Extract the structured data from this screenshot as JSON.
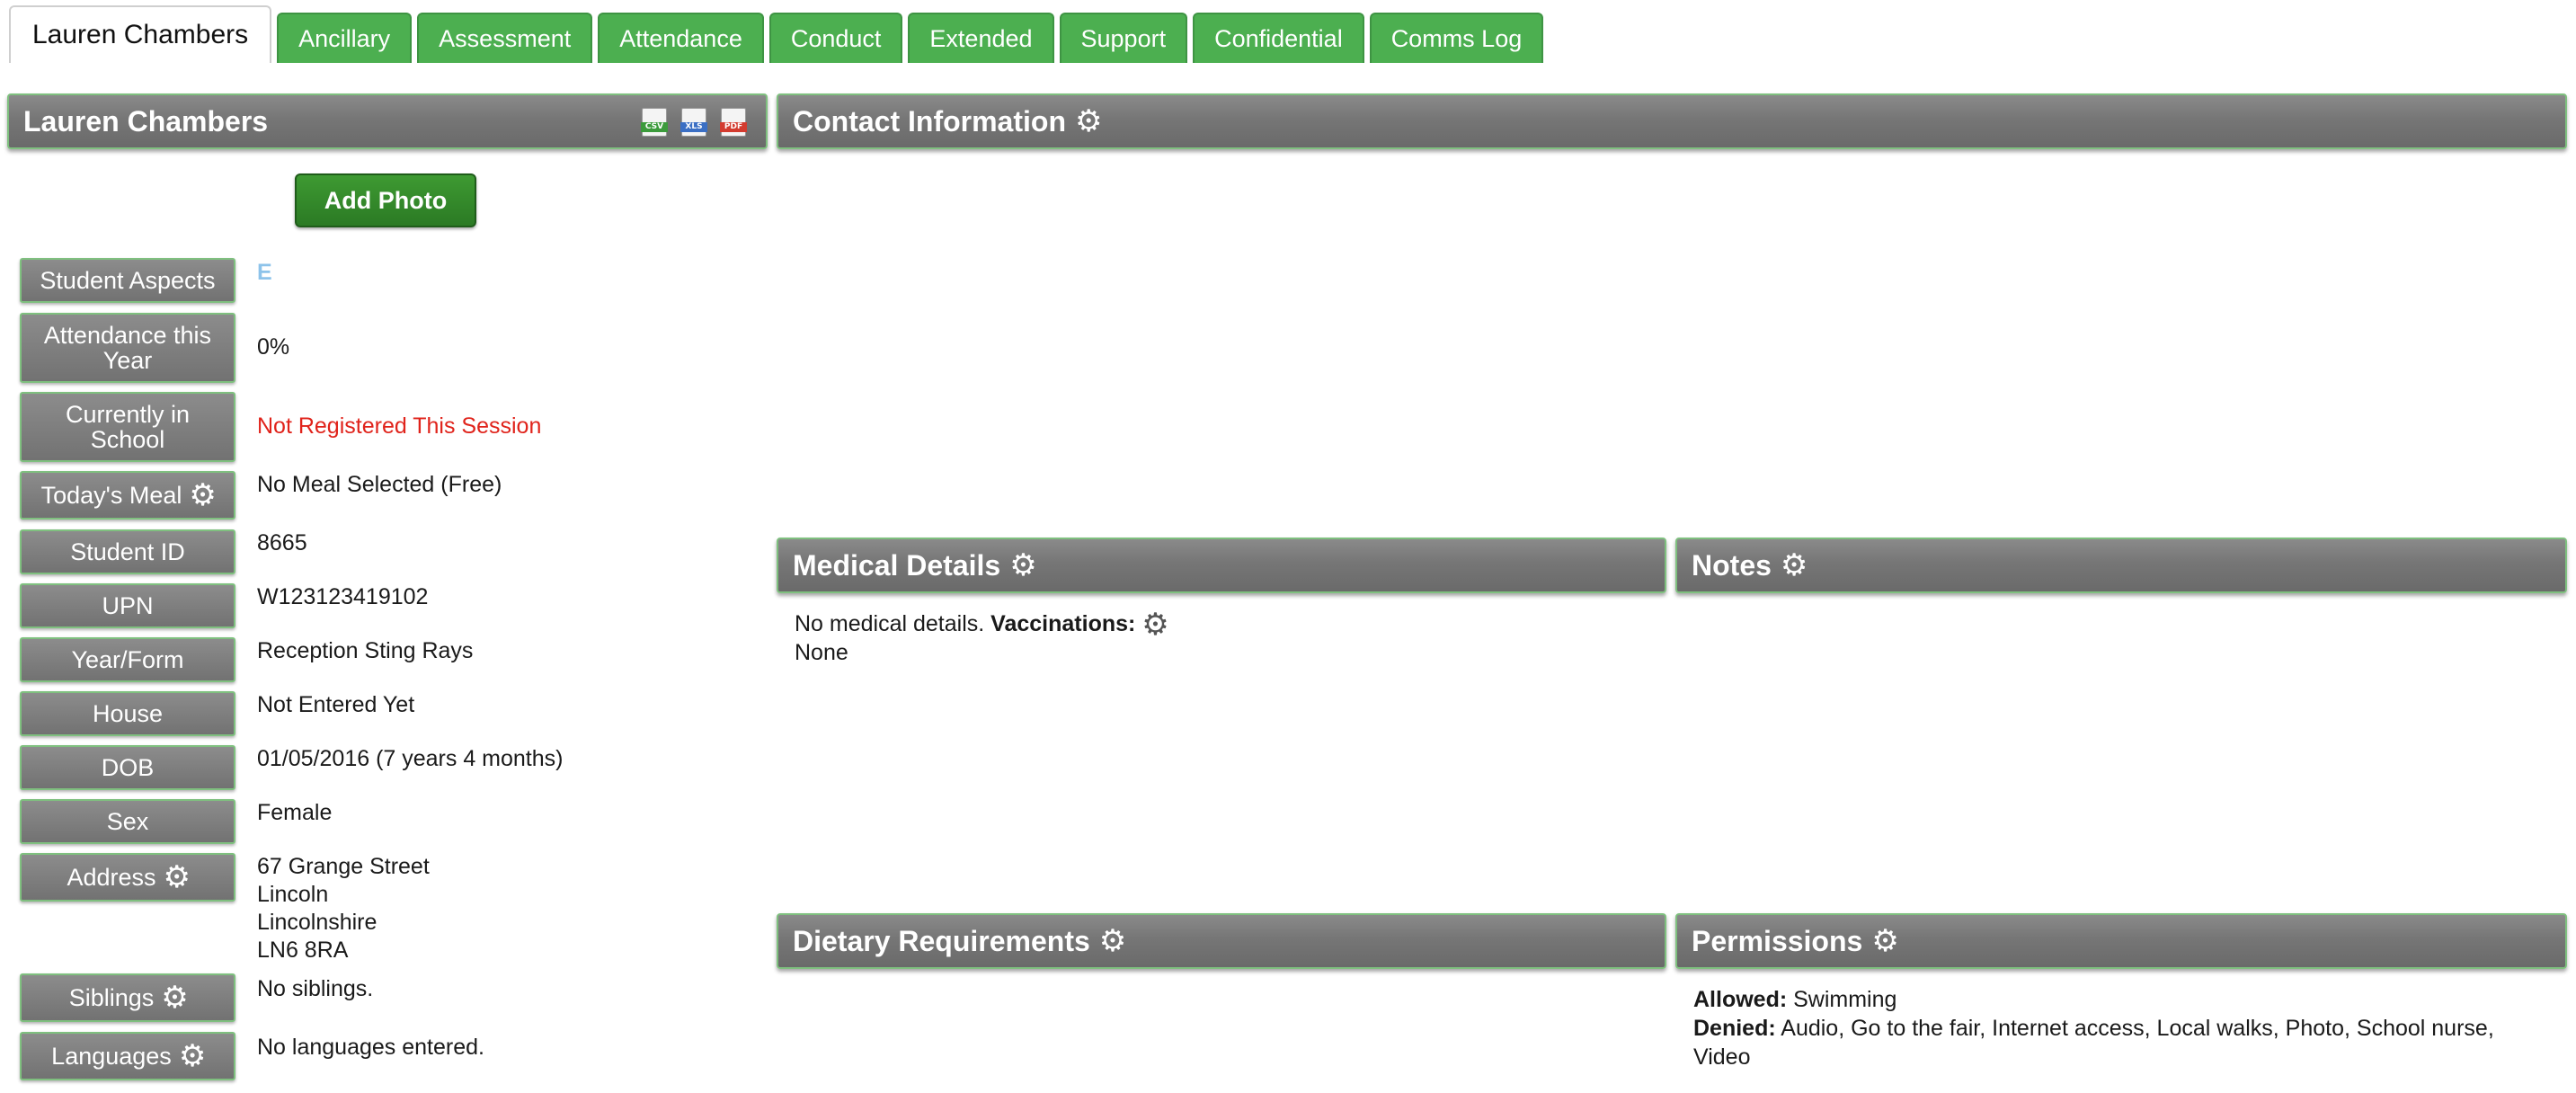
{
  "tabs": [
    {
      "label": "Lauren Chambers",
      "active": true
    },
    {
      "label": "Ancillary"
    },
    {
      "label": "Assessment"
    },
    {
      "label": "Attendance"
    },
    {
      "label": "Conduct"
    },
    {
      "label": "Extended"
    },
    {
      "label": "Support"
    },
    {
      "label": "Confidential"
    },
    {
      "label": "Comms Log"
    }
  ],
  "student_panel": {
    "title": "Lauren Chambers",
    "export_icons": [
      {
        "name": "csv-export-icon",
        "label": "CSV"
      },
      {
        "name": "xls-export-icon",
        "label": "XLS"
      },
      {
        "name": "pdf-export-icon",
        "label": "PDF"
      }
    ],
    "add_photo_label": "Add Photo"
  },
  "details": {
    "student_aspects": {
      "label": "Student Aspects",
      "value": "E"
    },
    "attendance": {
      "label": "Attendance this Year",
      "value": "0%"
    },
    "currently_in_school": {
      "label": "Currently in School",
      "value": "Not Registered This Session"
    },
    "todays_meal": {
      "label": "Today's Meal",
      "value": "No Meal Selected (Free)"
    },
    "student_id": {
      "label": "Student ID",
      "value": "8665"
    },
    "upn": {
      "label": "UPN",
      "value": "W123123419102"
    },
    "year_form": {
      "label": "Year/Form",
      "value": "Reception Sting Rays"
    },
    "house": {
      "label": "House",
      "value": "Not Entered Yet"
    },
    "dob": {
      "label": "DOB",
      "value": "01/05/2016 (7 years 4 months)"
    },
    "sex": {
      "label": "Sex",
      "value": "Female"
    },
    "address": {
      "label": "Address",
      "lines": [
        "67 Grange Street",
        "Lincoln",
        "Lincolnshire",
        "LN6 8RA"
      ]
    },
    "siblings": {
      "label": "Siblings",
      "value": "No siblings."
    },
    "languages": {
      "label": "Languages",
      "value": "No languages entered."
    }
  },
  "contact_panel": {
    "title": "Contact Information"
  },
  "medical_panel": {
    "title": "Medical Details",
    "text": "No medical details.",
    "vaccinations_label": "Vaccinations:",
    "vaccinations_value": "None"
  },
  "notes_panel": {
    "title": "Notes"
  },
  "dietary_panel": {
    "title": "Dietary Requirements"
  },
  "permissions_panel": {
    "title": "Permissions",
    "allowed_label": "Allowed:",
    "allowed_value": "Swimming",
    "denied_label": "Denied:",
    "denied_value": "Audio, Go to the fair, Internet access, Local walks, Photo, School nurse, Video"
  },
  "colors": {
    "tab_green": "#4caf50",
    "header_gray": "#777777",
    "alert_red": "#e0231b",
    "button_green": "#2f8a28"
  }
}
